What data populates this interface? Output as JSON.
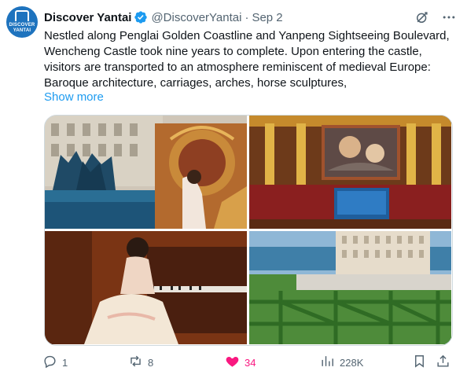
{
  "account": {
    "display_name": "Discover Yantai",
    "handle": "@DiscoverYantai",
    "separator": "·",
    "date": "Sep 2",
    "avatar_text_1": "DISCOVER",
    "avatar_text_2": "YANTAI"
  },
  "tweet": {
    "text": "Nestled along Penglai Golden Coastline and Yanpeng Sightseeing Boulevard, Wencheng Castle took nine years to complete. Upon entering the castle, visitors are transported to an atmosphere reminiscent of medieval Europe: Baroque architecture, carriages, arches, horse sculptures,",
    "show_more_label": "Show more"
  },
  "media": {
    "photo_icons": [
      "fountain-carriage-photo",
      "baroque-hall-photo",
      "piano-player-photo",
      "castle-garden-photo"
    ]
  },
  "actions": {
    "replies": "1",
    "reposts": "8",
    "likes": "34",
    "views": "228K"
  },
  "colors": {
    "accent": "#1d9bf0",
    "like": "#f91880",
    "muted": "#536471",
    "text": "#0f1419"
  }
}
